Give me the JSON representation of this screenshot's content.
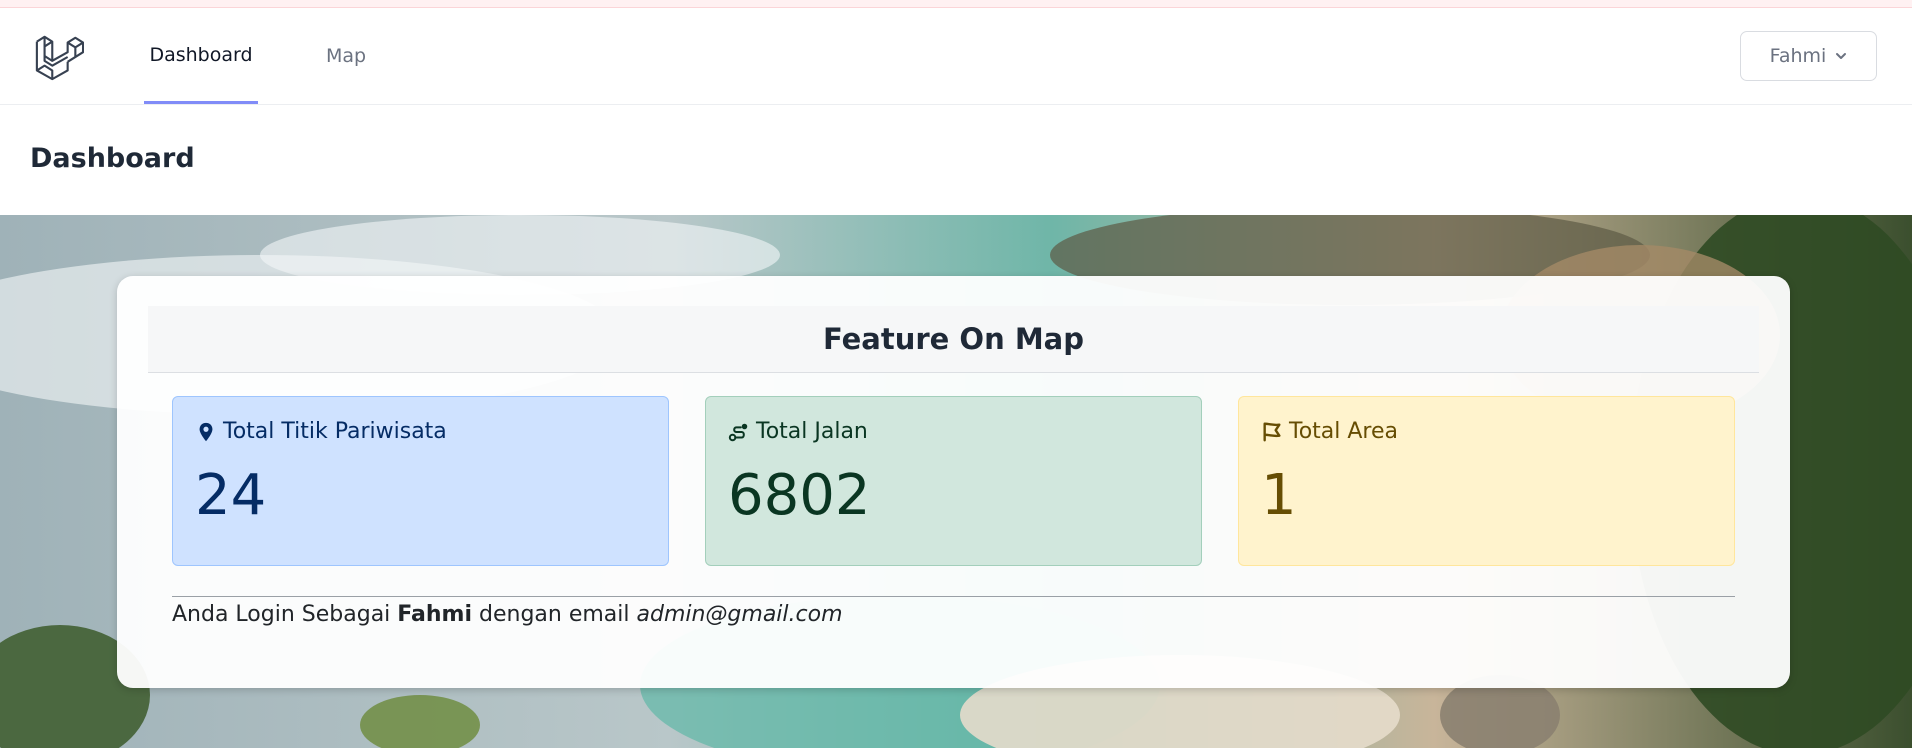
{
  "nav": {
    "links": [
      "Dashboard",
      "Map"
    ],
    "active": "Dashboard",
    "user": "Fahmi"
  },
  "header": {
    "title": "Dashboard"
  },
  "card": {
    "title": "Feature On Map",
    "stats": [
      {
        "label": "Total Titik Pariwisata",
        "value": "24",
        "icon": "map-pin-icon",
        "color": "#052c65"
      },
      {
        "label": "Total Jalan",
        "value": "6802",
        "icon": "route-icon",
        "color": "#0a3622"
      },
      {
        "label": "Total Area",
        "value": "1",
        "icon": "area-icon",
        "color": "#664d03"
      }
    ],
    "login": {
      "prefix": "Anda Login Sebagai",
      "name": "Fahmi",
      "middle": "dengan email",
      "email": "admin@gmail.com"
    }
  },
  "colors": {
    "accent": "#818cf8",
    "blue": "#cfe2ff",
    "green": "#d1e7dd",
    "yellow": "#fff3cd"
  }
}
